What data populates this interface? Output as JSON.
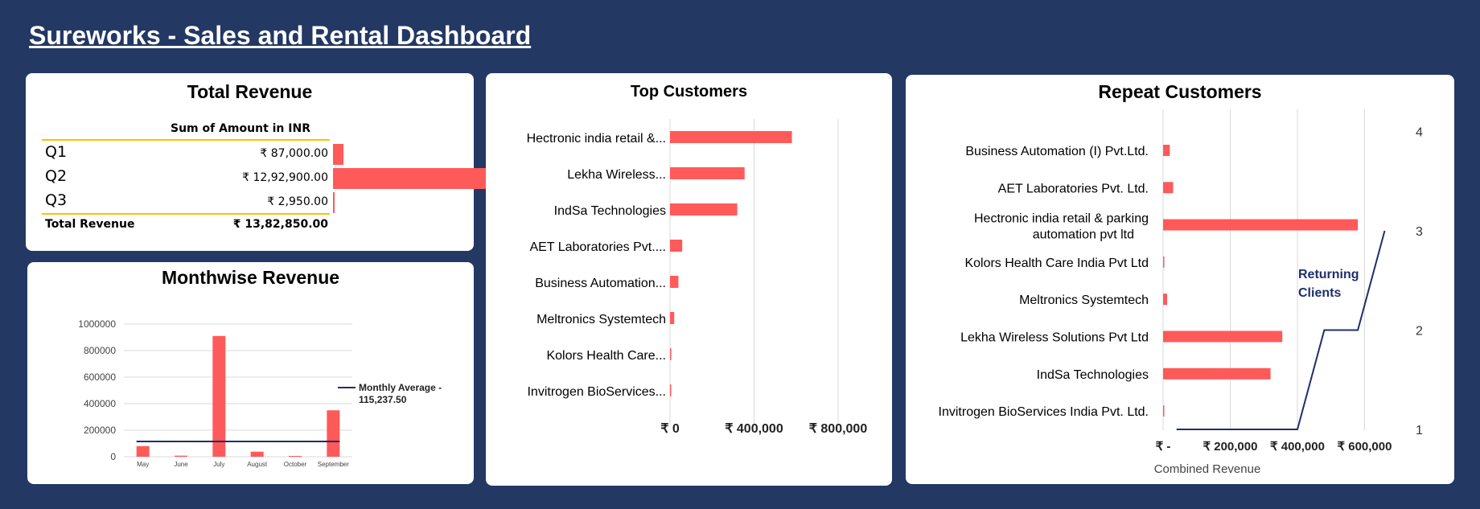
{
  "page": {
    "title": "Sureworks - Sales and Rental Dashboard"
  },
  "total_revenue": {
    "title": "Total Revenue",
    "column_header": "Sum of Amount in INR",
    "rows": [
      {
        "label": "Q1",
        "value": "₹ 87,000.00",
        "amount": 87000
      },
      {
        "label": "Q2",
        "value": "₹ 12,92,900.00",
        "amount": 1292900
      },
      {
        "label": "Q3",
        "value": "₹ 2,950.00",
        "amount": 2950
      }
    ],
    "total_label": "Total Revenue",
    "total_value": "₹ 13,82,850.00"
  },
  "monthwise": {
    "title": "Monthwise Revenue",
    "legend": "Monthly Average - 115,237.50"
  },
  "top_customers": {
    "title": "Top Customers"
  },
  "repeat_customers": {
    "title": "Repeat Customers",
    "annotation": "Returning Clients",
    "xlabel": "Combined Revenue"
  },
  "colors": {
    "background": "#233863",
    "bar": "#FF5A5A",
    "line": "#1F2E6B",
    "accent": "#FFC000"
  },
  "chart_data": [
    {
      "type": "bar",
      "title": "Monthwise Revenue",
      "categories": [
        "May",
        "June",
        "July",
        "August",
        "October",
        "September"
      ],
      "series": [
        {
          "values": [
            80000,
            8000,
            910000,
            38000,
            6000,
            350000
          ]
        },
        {
          "name": "Monthly Average - 115,237.50",
          "type": "line",
          "values": [
            115237.5,
            115237.5,
            115237.5,
            115237.5,
            115237.5,
            115237.5
          ]
        }
      ],
      "ylim": [
        0,
        1000000
      ],
      "yticks": [
        "0",
        "200000",
        "400000",
        "600000",
        "800000",
        "1000000"
      ],
      "grid": true,
      "legend": "right"
    },
    {
      "type": "bar",
      "orientation": "horizontal",
      "title": "Top Customers",
      "categories": [
        "Hectronic india retail &...",
        "Lekha Wireless...",
        "IndSa Technologies",
        "AET Laboratories Pvt....",
        "Business Automation...",
        "Meltronics Systemtech",
        "Kolors Health Care...",
        "Invitrogen BioServices..."
      ],
      "values": [
        580000,
        355000,
        320000,
        58000,
        40000,
        20000,
        5000,
        3000
      ],
      "xlim": [
        0,
        900000
      ],
      "xticks": [
        {
          "v": 0,
          "label": "₹ 0"
        },
        {
          "v": 400000,
          "label": "₹ 400,000"
        },
        {
          "v": 800000,
          "label": "₹ 800,000"
        }
      ],
      "grid": true
    },
    {
      "type": "bar",
      "orientation": "horizontal",
      "title": "Repeat Customers",
      "categories": [
        "Business Automation (I) Pvt.Ltd.",
        "AET Laboratories Pvt. Ltd.",
        "Hectronic india retail & parking|automation pvt ltd",
        "Kolors Health Care India Pvt Ltd",
        "Meltronics Systemtech",
        "Lekha Wireless Solutions Pvt Ltd",
        "IndSa Technologies",
        "Invitrogen BioServices India Pvt. Ltd."
      ],
      "values": [
        20000,
        30000,
        580000,
        2000,
        12000,
        355000,
        320000,
        3000
      ],
      "xlim": [
        0,
        650000
      ],
      "xticks": [
        {
          "v": 0,
          "label": "₹ -"
        },
        {
          "v": 200000,
          "label": "₹ 200,000"
        },
        {
          "v": 400000,
          "label": "₹ 400,000"
        },
        {
          "v": 600000,
          "label": "₹ 600,000"
        }
      ],
      "xlabel": "Combined Revenue",
      "secondary": {
        "name": "Returning Clients",
        "type": "line",
        "ylim": [
          1,
          4
        ],
        "yticks": [
          "1",
          "2",
          "3",
          "4"
        ],
        "x": [
          40000,
          400000,
          480000,
          580000,
          660000
        ],
        "y": [
          1,
          1,
          2,
          2,
          3
        ]
      },
      "grid": true
    }
  ]
}
